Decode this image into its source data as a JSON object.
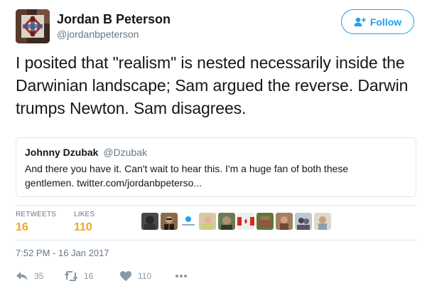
{
  "author": {
    "name": "Jordan B Peterson",
    "handle": "@jordanbpeterson"
  },
  "follow_button": {
    "label": "Follow",
    "icon": "add-user-icon"
  },
  "tweet": {
    "text": "I posited that \"realism\" is nested necessarily inside the Darwinian landscape; Sam argued the reverse. Darwin trumps Newton. Sam disagrees."
  },
  "quoted_tweet": {
    "name": "Johnny Dzubak",
    "handle": "@Dzubak",
    "text": "And there you have it. Can't wait to hear this. I'm a huge fan of both these gentlemen. twitter.com/jordanbpeterso..."
  },
  "stats": {
    "retweets_label": "RETWEETS",
    "retweets_count": "16",
    "likes_label": "LIKES",
    "likes_count": "110"
  },
  "timestamp": "7:52 PM - 16 Jan 2017",
  "actions": {
    "reply_count": "35",
    "retweet_count": "16",
    "like_count": "110"
  },
  "colors": {
    "accent": "#1da1f2",
    "stat_number": "#f5a623",
    "muted": "#657786",
    "action_grey": "#8899a6"
  }
}
